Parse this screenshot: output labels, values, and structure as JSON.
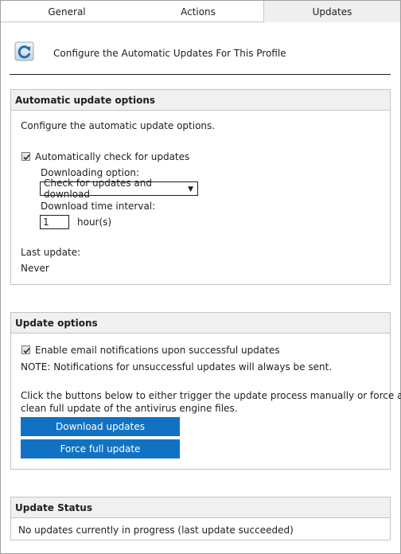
{
  "tabs": [
    {
      "label": "General",
      "active": false
    },
    {
      "label": "Actions",
      "active": false
    },
    {
      "label": "Updates",
      "active": true
    }
  ],
  "header": {
    "icon": "refresh-update-icon",
    "text": "Configure the Automatic Updates For This Profile"
  },
  "auto_update": {
    "title": "Automatic update options",
    "description": "Configure the automatic update options.",
    "auto_check_label": "Automatically check for updates",
    "auto_check_checked": true,
    "downloading_option_label": "Downloading option:",
    "downloading_option_value": "Check for updates and download",
    "interval_label": "Download time interval:",
    "interval_value": "1",
    "interval_unit": "hour(s)",
    "last_update_label": "Last update:",
    "last_update_value": "Never"
  },
  "update_options": {
    "title": "Update options",
    "email_label": "Enable email notifications upon successful updates",
    "email_checked": true,
    "note": "NOTE: Notifications for unsuccessful updates will always be sent.",
    "instructions_line1": "Click the buttons below to either trigger the update process manually or force a",
    "instructions_line2": "clean full update of the antivirus engine files.",
    "download_button": "Download updates",
    "force_button": "Force full update"
  },
  "status": {
    "title": "Update Status",
    "text": "No updates currently in progress (last update succeeded)"
  },
  "colors": {
    "button": "#1172c4",
    "section_header": "#f0f0f0",
    "active_tab": "#efefef"
  }
}
